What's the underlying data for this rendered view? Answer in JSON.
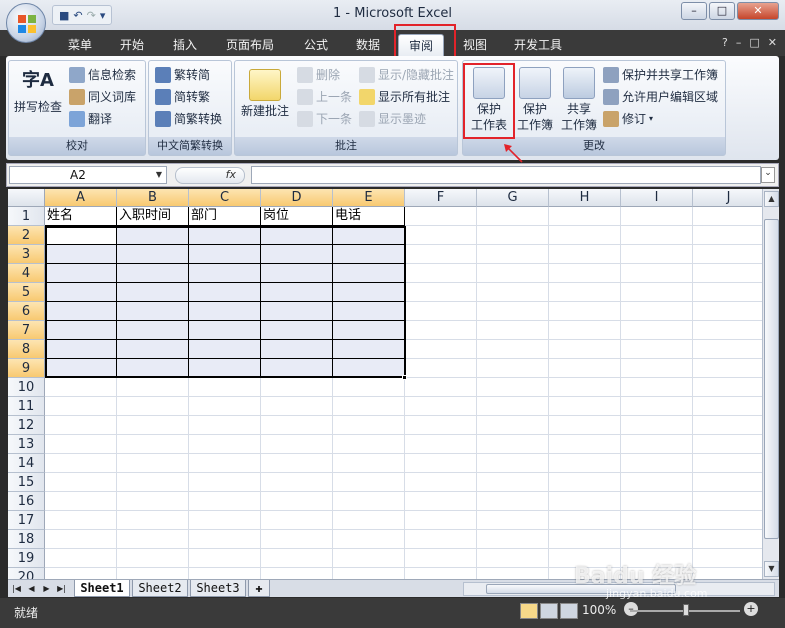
{
  "window": {
    "title": "1 - Microsoft Excel"
  },
  "qat": {
    "items": [
      "save-icon",
      "undo-icon",
      "redo-icon",
      "customize-icon"
    ]
  },
  "tabs": [
    {
      "label": "菜单",
      "active": false
    },
    {
      "label": "开始",
      "active": false
    },
    {
      "label": "插入",
      "active": false
    },
    {
      "label": "页面布局",
      "active": false
    },
    {
      "label": "公式",
      "active": false
    },
    {
      "label": "数据",
      "active": false
    },
    {
      "label": "审阅",
      "active": true
    },
    {
      "label": "视图",
      "active": false
    },
    {
      "label": "开发工具",
      "active": false
    }
  ],
  "ribbon": {
    "proofing": {
      "label": "校对",
      "spellcheck": "拼写检查",
      "research": "信息检索",
      "thesaurus": "同义词库",
      "translate": "翻译"
    },
    "chinese": {
      "label": "中文简繁转换",
      "to_simplified": "繁转简",
      "to_traditional": "简转繁",
      "convert": "简繁转换"
    },
    "comments": {
      "label": "批注",
      "new": "新建批注",
      "delete": "删除",
      "previous": "上一条",
      "next": "下一条",
      "show_hide": "显示/隐藏批注",
      "show_all": "显示所有批注",
      "show_ink": "显示墨迹"
    },
    "changes": {
      "label": "更改",
      "protect_sheet_l1": "保护",
      "protect_sheet_l2": "工作表",
      "protect_book_l1": "保护",
      "protect_book_l2": "工作簿",
      "share_book_l1": "共享",
      "share_book_l2": "工作簿",
      "protect_share": "保护并共享工作簿",
      "allow_edit": "允许用户编辑区域",
      "track": "修订"
    }
  },
  "formula": {
    "namebox": "A2",
    "fx": "fx",
    "value": ""
  },
  "columns": [
    "A",
    "B",
    "C",
    "D",
    "E",
    "F",
    "G",
    "H",
    "I",
    "J"
  ],
  "rows": [
    "1",
    "2",
    "3",
    "4",
    "5",
    "6",
    "7",
    "8",
    "9",
    "10",
    "11",
    "12",
    "13",
    "14",
    "15",
    "16",
    "17",
    "18",
    "19",
    "20"
  ],
  "headers": [
    "姓名",
    "入职时间",
    "部门",
    "岗位",
    "电话"
  ],
  "sheets": [
    "Sheet1",
    "Sheet2",
    "Sheet3"
  ],
  "status": {
    "text": "就绪",
    "zoom": "100%"
  },
  "watermark": {
    "main": "Baidu 经验",
    "sub": "jingyan.baidu.com"
  }
}
